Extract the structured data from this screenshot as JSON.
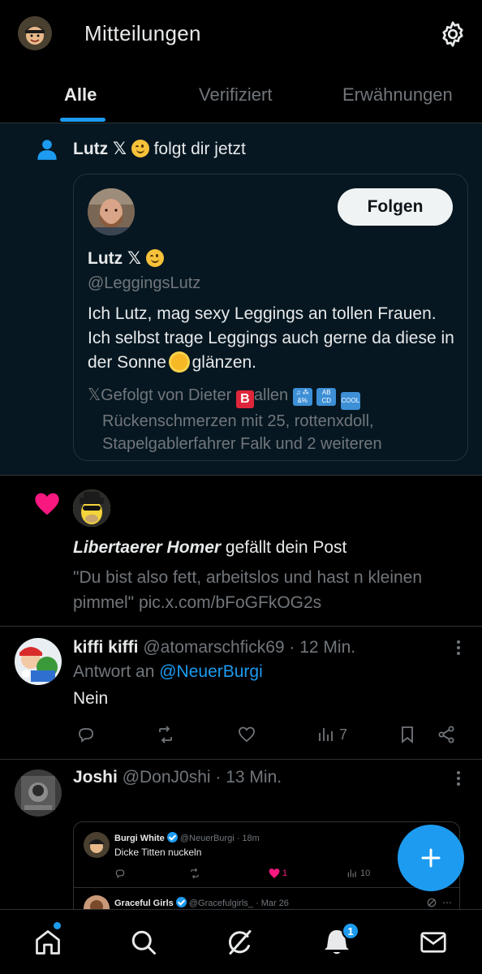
{
  "header": {
    "title": "Mitteilungen",
    "tabs": [
      {
        "label": "Alle",
        "active": true
      },
      {
        "label": "Verifiziert",
        "active": false
      },
      {
        "label": "Erwähnungen",
        "active": false
      }
    ],
    "settings_icon": "gear-icon"
  },
  "follow_notification": {
    "name": "Lutz 𝕏",
    "action_text": "folgt dir jetzt",
    "follow_button": "Folgen",
    "card": {
      "name": "Lutz 𝕏",
      "handle": "@LeggingsLutz",
      "bio_1": "Ich Lutz, mag sexy Leggings an tollen Frauen.  Ich selbst trage Leggings auch gerne da diese in der Sonne",
      "bio_2": "glänzen.",
      "followed_prefix": "𝕏Gefolgt von Dieter",
      "followed_mid": "allen",
      "followed_line2": "Rückenschmerzen mit 25, rottenxdoll,",
      "followed_line3": "Stapelgablerfahrer Falk und 2 weiteren"
    }
  },
  "like_notification": {
    "name": "Libertaerer Homer",
    "action_text": "gefällt dein Post",
    "quote": "\"Du bist also fett, arbeitslos und hast n kleinen pimmel\" pic.x.com/bFoGFkOG2s"
  },
  "tweet_reply": {
    "name": "kiffi kiffi",
    "meta": "@atomarschfick69 · 12 Min.",
    "reply_prefix": "Antwort an",
    "reply_handle": "@NeuerBurgi",
    "text": "Nein",
    "views": "7"
  },
  "tweet_quote": {
    "name": "Joshi",
    "meta": "@DonJ0shi · 13 Min.",
    "embedded": [
      {
        "name": "Burgi White",
        "meta": "@NeuerBurgi · 18m",
        "text": "Dicke Titten nuckeln",
        "likes": "1",
        "views": "10"
      },
      {
        "name": "Graceful Girls",
        "meta": "@Gracefulgirls_ · Mar 26"
      }
    ]
  },
  "bottom_nav": {
    "items": [
      "home-icon",
      "search-icon",
      "grok-icon",
      "notifications-icon",
      "messages-icon"
    ],
    "notification_badge": "1"
  },
  "colors": {
    "accent": "#1d9bf0",
    "like": "#f91880",
    "highlight_bg": "#061721"
  }
}
